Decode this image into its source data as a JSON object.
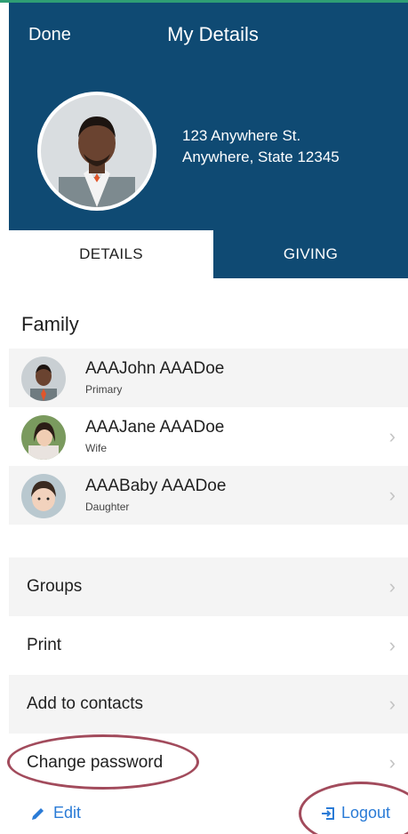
{
  "header": {
    "done_label": "Done",
    "title": "My Details",
    "address_line1": "123 Anywhere St.",
    "address_line2": "Anywhere, State 12345",
    "background_color": "#0f4a73"
  },
  "tabs": [
    {
      "label": "DETAILS",
      "active": true
    },
    {
      "label": "GIVING",
      "active": false
    }
  ],
  "family": {
    "title": "Family",
    "members": [
      {
        "name": "AAAJohn AAADoe",
        "role": "Primary",
        "has_chevron": false
      },
      {
        "name": "AAAJane AAADoe",
        "role": "Wife",
        "has_chevron": true
      },
      {
        "name": "AAABaby AAADoe",
        "role": "Daughter",
        "has_chevron": true
      }
    ]
  },
  "menu": [
    {
      "label": "Groups"
    },
    {
      "label": "Print"
    },
    {
      "label": "Add to contacts"
    },
    {
      "label": "Change password"
    }
  ],
  "footer": {
    "edit_label": "Edit",
    "logout_label": "Logout",
    "accent_color": "#2a7bd6"
  },
  "chevron_glyph": "›"
}
